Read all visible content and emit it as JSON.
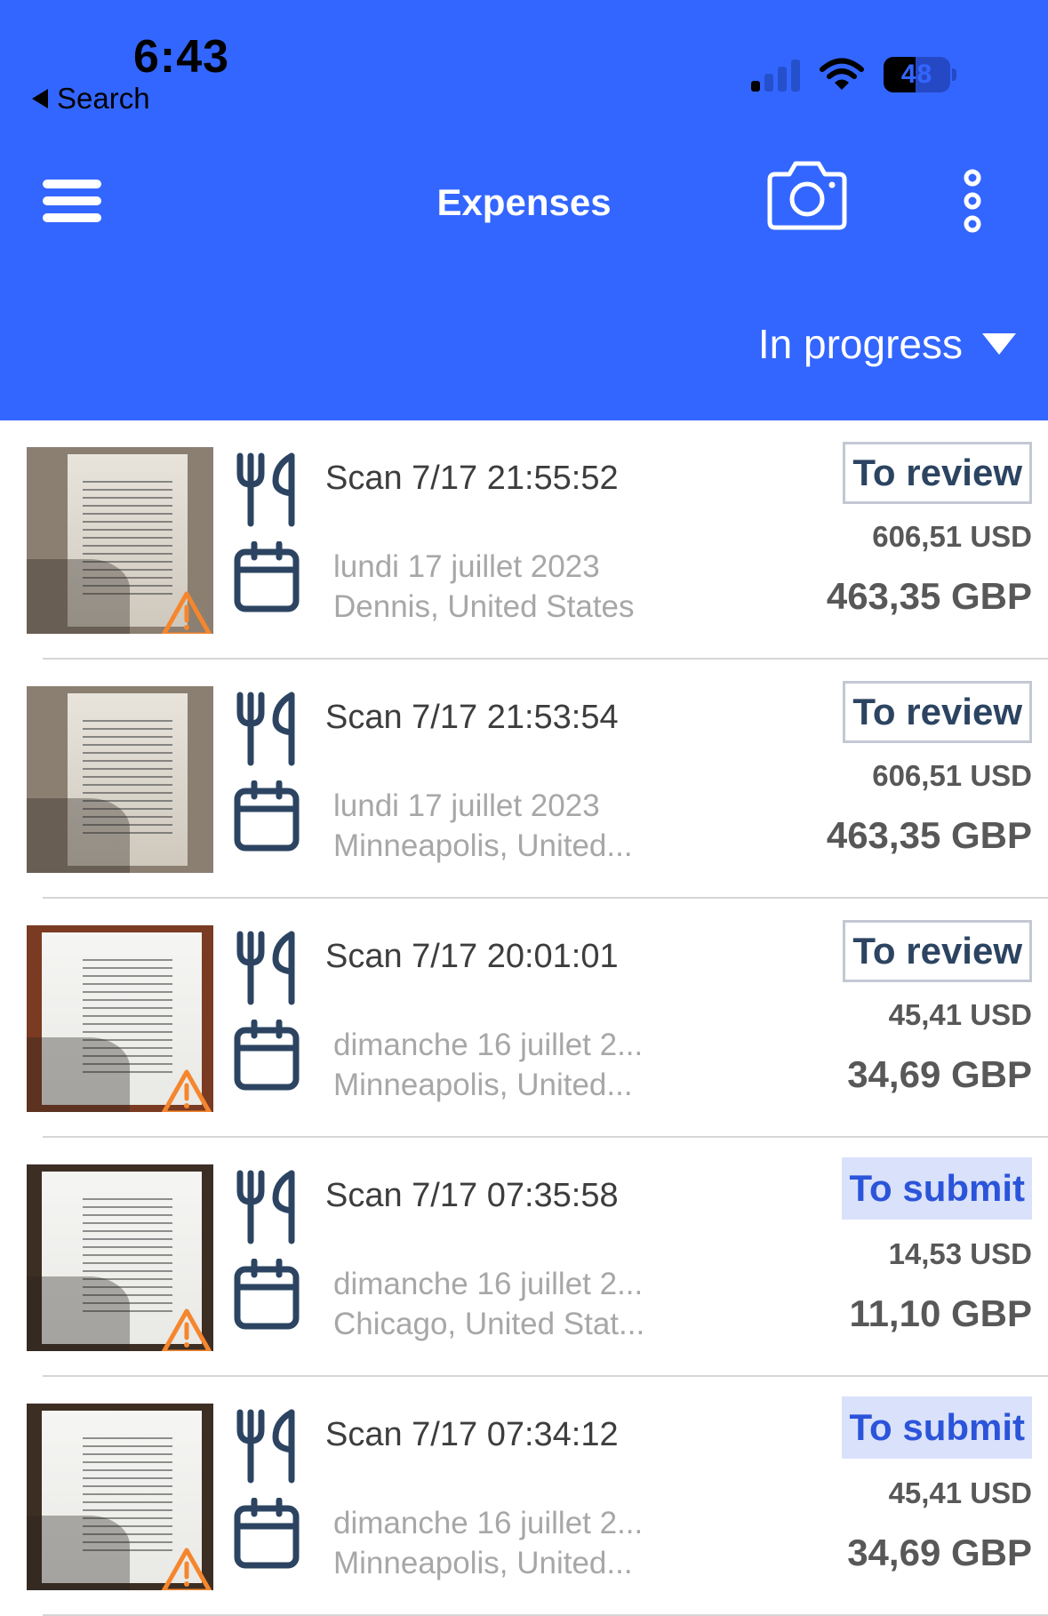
{
  "status_bar": {
    "time": "6:43",
    "back_label": "Search",
    "signal_bars_active": 1,
    "signal_bars_total": 4,
    "battery_percent": 48
  },
  "header": {
    "title": "Expenses",
    "menu_icon": "hamburger-menu-icon",
    "camera_icon": "camera-icon",
    "more_icon": "more-vertical-icon",
    "filter_selected": "In progress",
    "background_color": "#3366ff"
  },
  "colors": {
    "review_text": "#2c4461",
    "review_border": "#c3c8d3",
    "submit_text": "#2b54d9",
    "submit_bg": "#d9e1fb",
    "warning": "#f5862e",
    "icon": "#2c4461"
  },
  "expenses": [
    {
      "title": "Scan 7/17 21:55:52",
      "category_icon": "fork-knife-icon",
      "date": "lundi 17 juillet 2023",
      "location": "Dennis, United States",
      "status": "To review",
      "status_type": "review",
      "amount_original": "606,51 USD",
      "amount_converted": "463,35 GBP",
      "has_warning": true,
      "thumb_style": "grey"
    },
    {
      "title": "Scan 7/17 21:53:54",
      "category_icon": "fork-knife-icon",
      "date": "lundi 17 juillet 2023",
      "location": "Minneapolis, United...",
      "status": "To review",
      "status_type": "review",
      "amount_original": "606,51 USD",
      "amount_converted": "463,35 GBP",
      "has_warning": false,
      "thumb_style": "grey"
    },
    {
      "title": "Scan 7/17 20:01:01",
      "category_icon": "fork-knife-icon",
      "date": "dimanche 16 juillet 2...",
      "location": "Minneapolis, United...",
      "status": "To review",
      "status_type": "review",
      "amount_original": "45,41 USD",
      "amount_converted": "34,69 GBP",
      "has_warning": true,
      "thumb_style": "brown"
    },
    {
      "title": "Scan 7/17 07:35:58",
      "category_icon": "fork-knife-icon",
      "date": "dimanche 16 juillet 2...",
      "location": "Chicago, United Stat...",
      "status": "To submit",
      "status_type": "submit",
      "amount_original": "14,53 USD",
      "amount_converted": "11,10 GBP",
      "has_warning": true,
      "thumb_style": "dark"
    },
    {
      "title": "Scan 7/17 07:34:12",
      "category_icon": "fork-knife-icon",
      "date": "dimanche 16 juillet 2...",
      "location": "Minneapolis, United...",
      "status": "To submit",
      "status_type": "submit",
      "amount_original": "45,41 USD",
      "amount_converted": "34,69 GBP",
      "has_warning": true,
      "thumb_style": "dark"
    }
  ]
}
